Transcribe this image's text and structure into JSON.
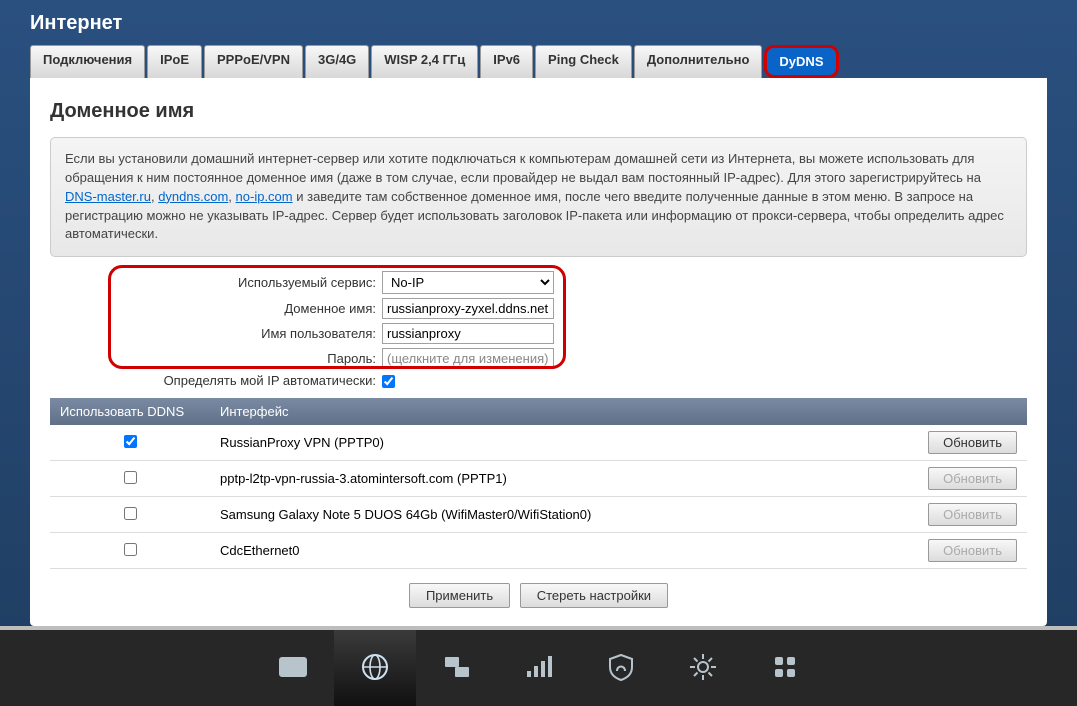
{
  "header": {
    "title": "Интернет"
  },
  "tabs": [
    {
      "label": "Подключения"
    },
    {
      "label": "IPoE"
    },
    {
      "label": "PPPoE/VPN"
    },
    {
      "label": "3G/4G"
    },
    {
      "label": "WISP 2,4 ГГц"
    },
    {
      "label": "IPv6"
    },
    {
      "label": "Ping Check"
    },
    {
      "label": "Дополнительно"
    },
    {
      "label": "DyDNS",
      "active": true
    }
  ],
  "section": {
    "title": "Доменное имя",
    "info_pre": "Если вы установили домашний интернет-сервер или хотите подключаться к компьютерам домашней сети из Интернета, вы можете использовать для обращения к ним постоянное доменное имя (даже в том случае, если провайдер не выдал вам постоянный IP-адрес). Для этого зарегистрируйтесь на ",
    "link1": "DNS-master.ru",
    "sep1": ", ",
    "link2": "dyndns.com",
    "sep2": ", ",
    "link3": "no-ip.com",
    "info_post": " и заведите там собственное доменное имя, после чего введите полученные данные в этом меню. В запросе на регистрацию можно не указывать IP-адрес. Сервер будет использовать заголовок IP-пакета или информацию от прокси-сервера, чтобы определить адрес автоматически."
  },
  "form": {
    "service_label": "Используемый сервис:",
    "service_value": "No-IP",
    "domain_label": "Доменное имя:",
    "domain_value": "russianproxy-zyxel.ddns.net",
    "user_label": "Имя пользователя:",
    "user_value": "russianproxy",
    "password_label": "Пароль:",
    "password_placeholder": "(щелкните для изменения)",
    "autoip_label": "Определять мой IP автоматически:"
  },
  "table": {
    "col_use": "Использовать DDNS",
    "col_iface": "Интерфейс",
    "refresh": "Обновить",
    "rows": [
      {
        "checked": true,
        "name": "RussianProxy VPN (PPTP0)",
        "enabled": true
      },
      {
        "checked": false,
        "name": "pptp-l2tp-vpn-russia-3.atomintersoft.com (PPTP1)",
        "enabled": false
      },
      {
        "checked": false,
        "name": "Samsung Galaxy Note 5 DUOS 64Gb (WifiMaster0/WifiStation0)",
        "enabled": false
      },
      {
        "checked": false,
        "name": "CdcEthernet0",
        "enabled": false
      }
    ]
  },
  "actions": {
    "apply": "Применить",
    "reset": "Стереть настройки"
  }
}
